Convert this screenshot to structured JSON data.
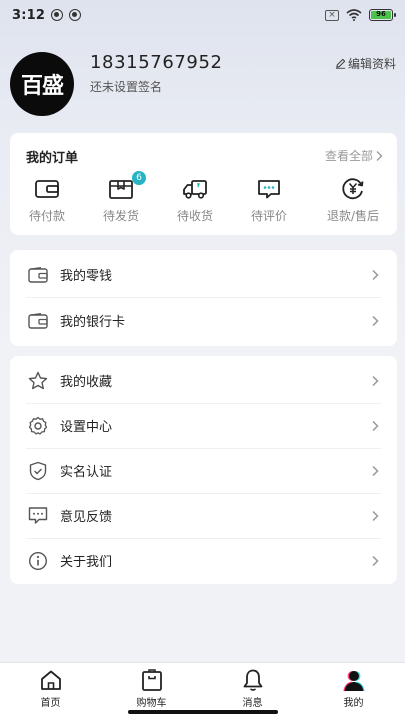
{
  "status_bar": {
    "time": "3:12",
    "battery": "96"
  },
  "profile": {
    "avatar_text": "百盛",
    "phone": "18315767952",
    "signature": "还未设置签名",
    "edit_label": "编辑资料"
  },
  "orders": {
    "title": "我的订单",
    "view_all": "查看全部",
    "items": [
      {
        "label": "待付款",
        "icon": "wallet-icon"
      },
      {
        "label": "待发货",
        "icon": "package-icon",
        "badge": "6"
      },
      {
        "label": "待收货",
        "icon": "truck-icon"
      },
      {
        "label": "待评价",
        "icon": "comment-icon"
      },
      {
        "label": "退款/售后",
        "icon": "refund-icon"
      }
    ]
  },
  "wallet_menu": [
    {
      "label": "我的零钱",
      "icon": "wallet-icon"
    },
    {
      "label": "我的银行卡",
      "icon": "bank-card-icon"
    }
  ],
  "settings_menu": [
    {
      "label": "我的收藏",
      "icon": "star-icon"
    },
    {
      "label": "设置中心",
      "icon": "gear-icon"
    },
    {
      "label": "实名认证",
      "icon": "shield-icon"
    },
    {
      "label": "意见反馈",
      "icon": "feedback-icon"
    },
    {
      "label": "关于我们",
      "icon": "info-icon"
    }
  ],
  "tabs": [
    {
      "label": "首页",
      "icon": "home-icon"
    },
    {
      "label": "购物车",
      "icon": "cart-icon"
    },
    {
      "label": "消息",
      "icon": "bell-icon"
    },
    {
      "label": "我的",
      "icon": "profile-icon",
      "active": true
    }
  ],
  "colors": {
    "accent": "#27b4c4",
    "text": "#222222",
    "muted": "#888888",
    "background": "#f1f2f6"
  }
}
